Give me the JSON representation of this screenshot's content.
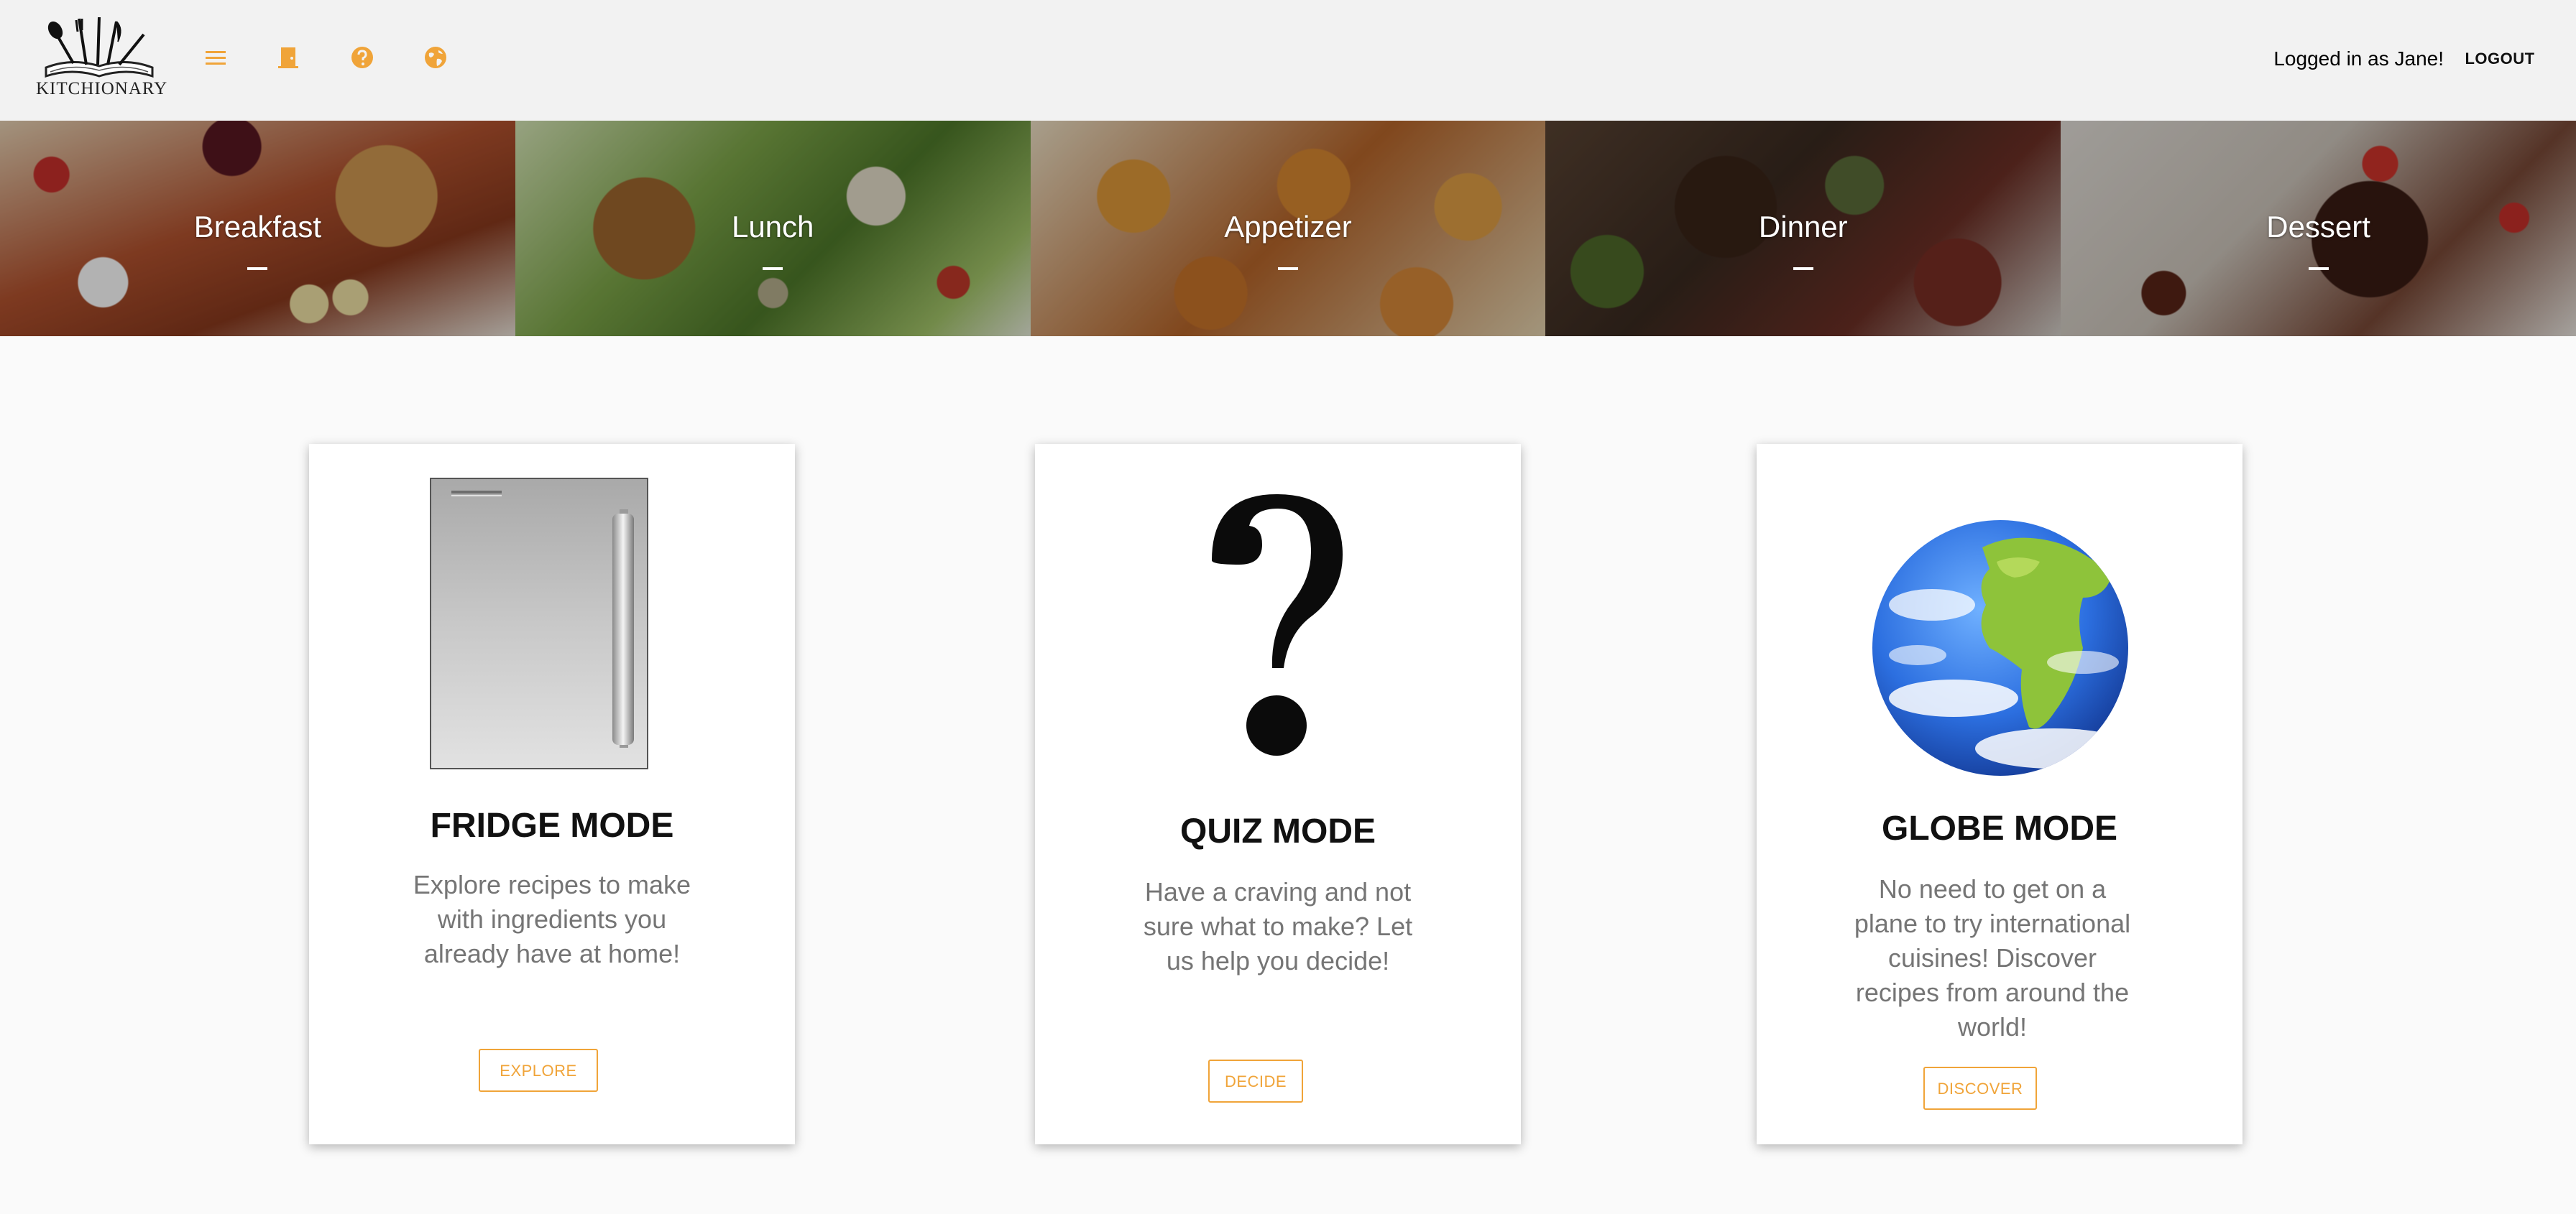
{
  "header": {
    "logo_text": "KITCHIONARY",
    "user_text": "Logged in as Jane!",
    "logout_label": "LOGOUT",
    "accent_color": "#f0a439",
    "icons": [
      "menu-icon",
      "door-icon",
      "help-icon",
      "globe-icon"
    ]
  },
  "categories": [
    {
      "label": "Breakfast"
    },
    {
      "label": "Lunch"
    },
    {
      "label": "Appetizer"
    },
    {
      "label": "Dinner"
    },
    {
      "label": "Dessert"
    }
  ],
  "cards": {
    "fridge": {
      "title": "FRIDGE MODE",
      "description": "Explore recipes to make with ingredients you already have at home!",
      "button": "EXPLORE",
      "image": "fridge-image"
    },
    "quiz": {
      "title": "QUIZ MODE",
      "description": "Have a craving and not sure what to make? Let us help you decide!",
      "button": "DECIDE",
      "image": "question-mark-image"
    },
    "globe": {
      "title": "GLOBE MODE",
      "description": "No need to get on a plane to try international cuisines! Discover recipes from around the world!",
      "button": "DISCOVER",
      "image": "globe-image"
    }
  }
}
